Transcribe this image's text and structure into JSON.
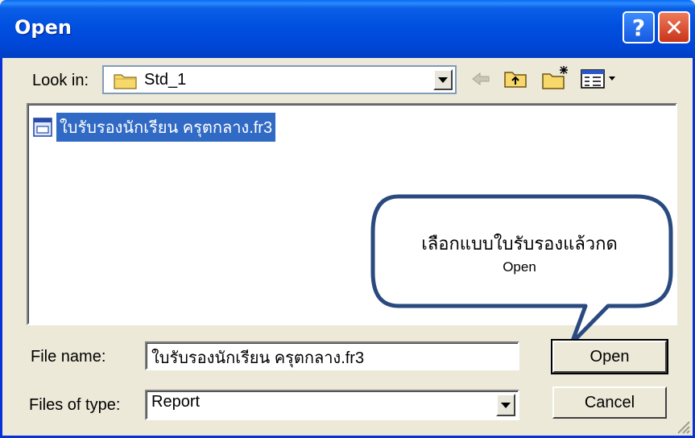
{
  "window": {
    "title": "Open",
    "help_icon": "help-icon",
    "close_icon": "close-icon"
  },
  "toolbar": {
    "look_in_label": "Look in:",
    "look_in_value": "Std_1",
    "icons": [
      "back-arrow-icon",
      "up-folder-icon",
      "new-folder-icon",
      "view-menu-icon"
    ]
  },
  "file_list": {
    "items": [
      {
        "name": "ใบรับรองนักเรียน ครุตกลาง.fr3",
        "icon": "report-file-icon",
        "selected": true
      }
    ]
  },
  "callout": {
    "line1": "เลือกแบบใบรับรองแล้วกด",
    "line2": "Open"
  },
  "filename": {
    "label": "File name:",
    "value": "ใบรับรองนักเรียน ครุตกลาง.fr3"
  },
  "filetype": {
    "label": "Files of type:",
    "value": "Report"
  },
  "buttons": {
    "open": "Open",
    "cancel": "Cancel"
  },
  "colors": {
    "title_bar": "#0050e0",
    "selection": "#316ac5",
    "callout_border": "#2a4a7f"
  }
}
